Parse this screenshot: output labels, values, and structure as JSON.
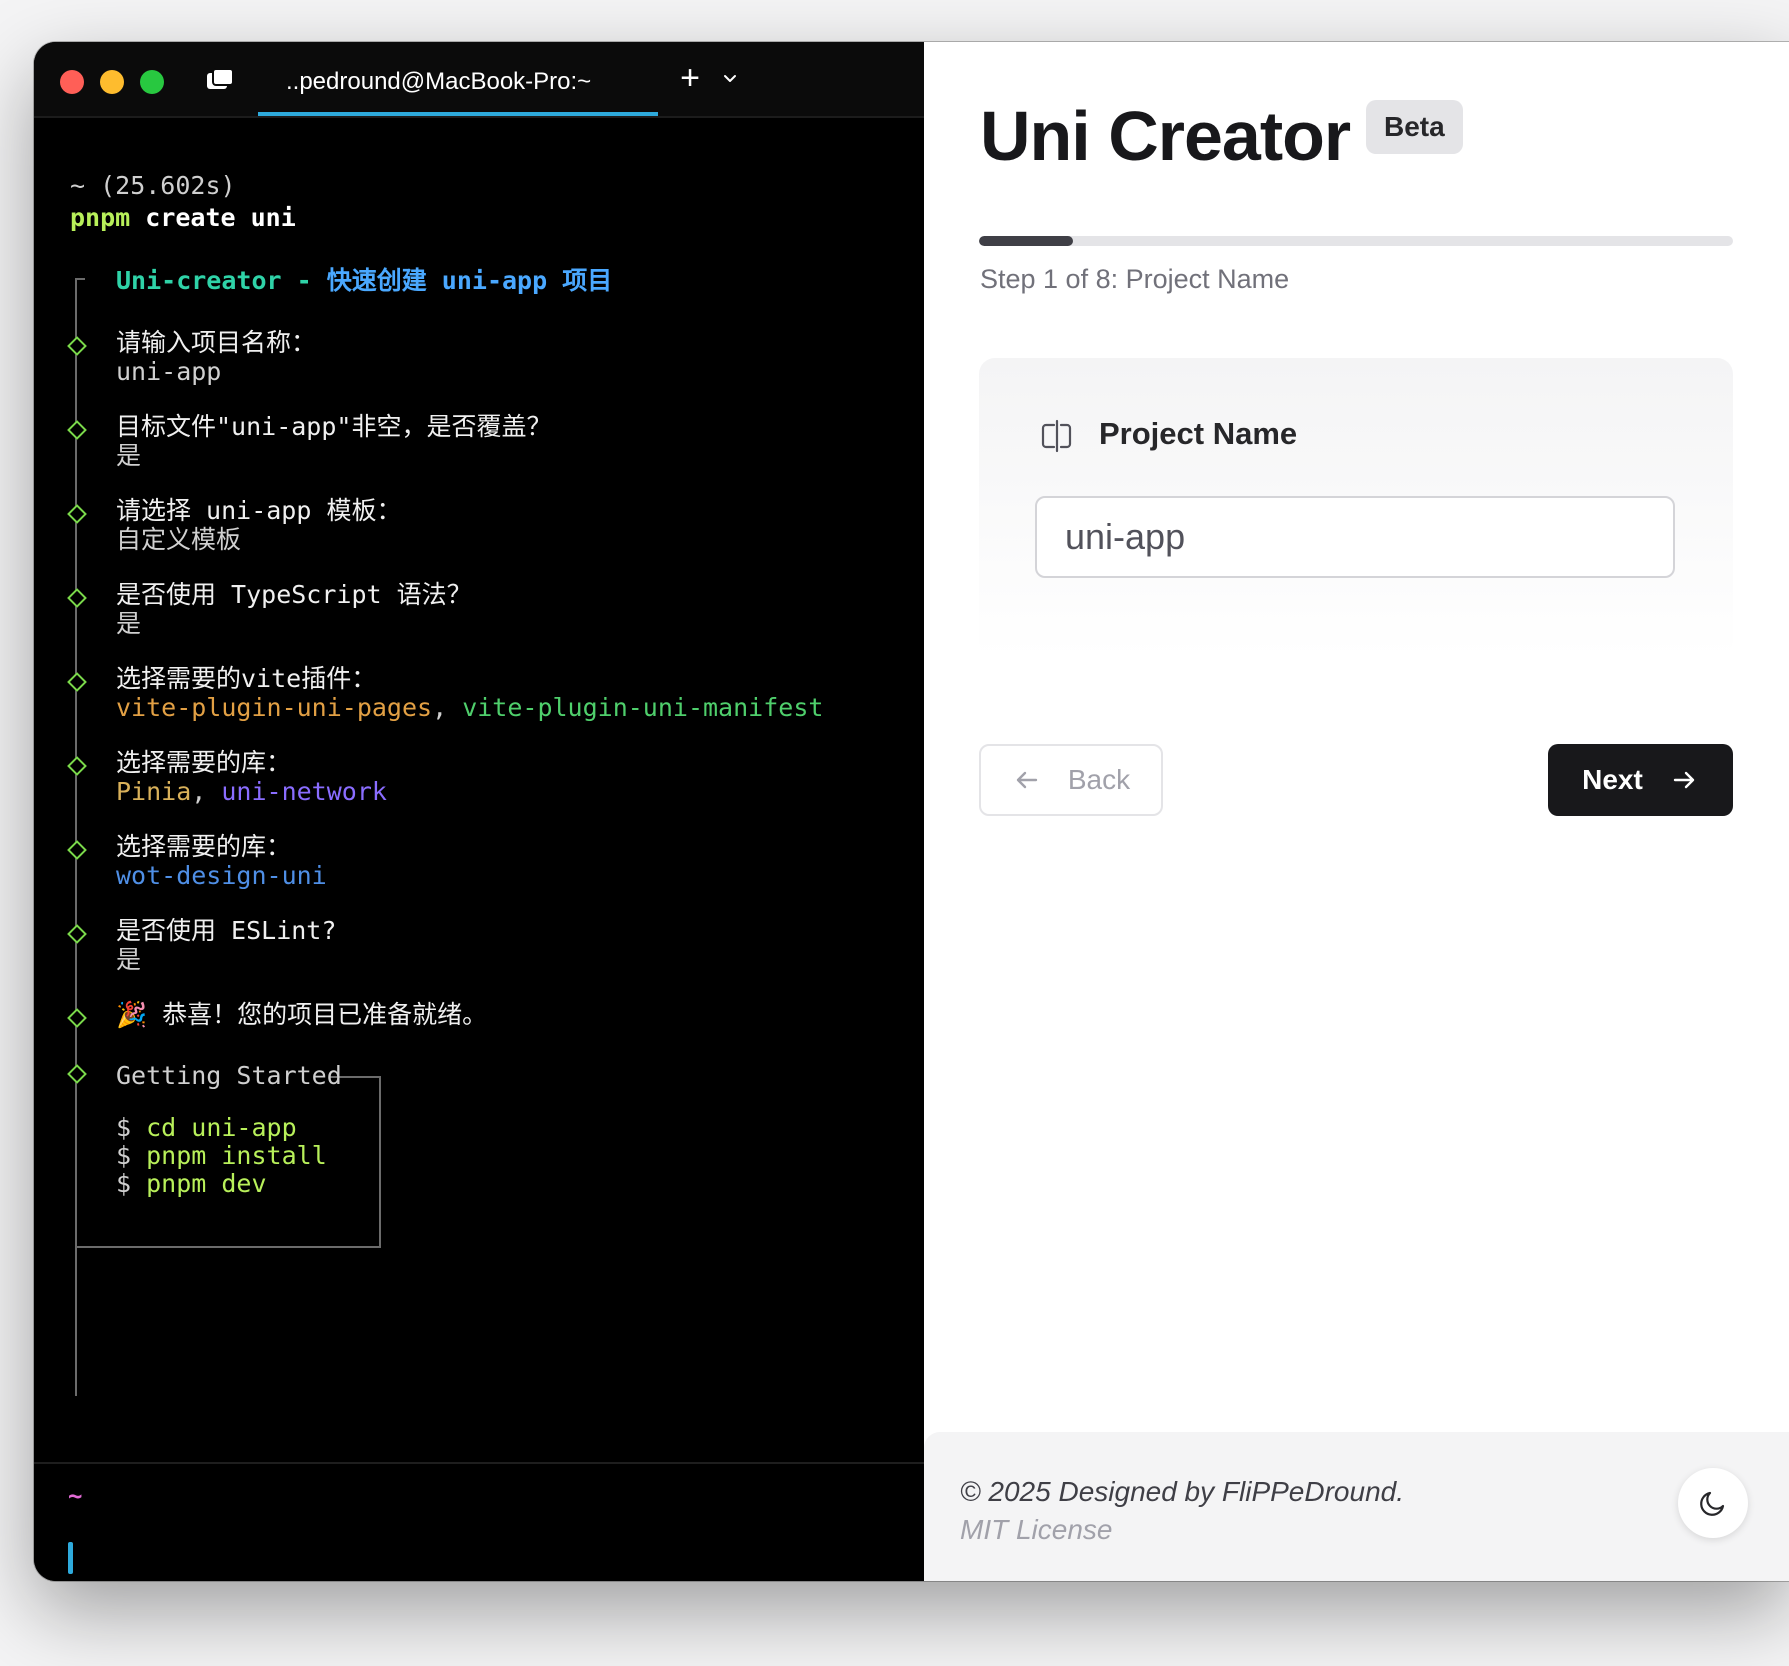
{
  "terminal": {
    "tab_title": "..pedround@MacBook-Pro:~",
    "new_tab_icon": "plus-icon",
    "timing": "~ (25.602s)",
    "command": {
      "tool": "pnpm",
      "rest": " create uni"
    },
    "header": {
      "name": "Uni-creator",
      "dash": " - ",
      "cn": "快速创建 ",
      "app": "uni-app",
      "cn2": " 项目"
    },
    "steps": [
      {
        "question": "请输入项目名称：",
        "answer": "uni-app"
      },
      {
        "question": "目标文件\"uni-app\"非空，是否覆盖？",
        "answer": "是"
      },
      {
        "question": "请选择 uni-app 模板：",
        "answer": "自定义模板"
      },
      {
        "question": "是否使用 TypeScript 语法？",
        "answer": "是"
      },
      {
        "question": "选择需要的vite插件：",
        "answer_parts": [
          "vite-plugin-uni-pages",
          ", ",
          "vite-plugin-uni-manifest"
        ]
      },
      {
        "question": "选择需要的库：",
        "answer_parts": [
          "Pinia",
          ", ",
          "uni-network"
        ]
      },
      {
        "question": "选择需要的库：",
        "answer": "wot-design-uni"
      },
      {
        "question": "是否使用 ESLint?",
        "answer": "是"
      }
    ],
    "success": "🎉 恭喜！您的项目已准备就绪。",
    "getting_started": {
      "title": "Getting Started",
      "commands": [
        {
          "prompt": "$",
          "text": "cd uni-app"
        },
        {
          "prompt": "$",
          "text": "pnpm install"
        },
        {
          "prompt": "$",
          "text": "pnpm dev"
        }
      ]
    },
    "prompt_symbol": "~"
  },
  "app": {
    "title": "Uni Creator",
    "badge": "Beta",
    "progress": {
      "current": 1,
      "total": 8
    },
    "step_label": "Step 1 of 8: Project Name",
    "field": {
      "label": "Project Name",
      "value": "uni-app",
      "icon": "text-cursor-input-icon"
    },
    "back_label": "Back",
    "next_label": "Next",
    "footer": {
      "copyright": "© 2025 Designed by FliPPeDround.",
      "license": "MIT License",
      "theme_icon": "moon-icon"
    }
  },
  "colors": {
    "terminal_bg": "#000000",
    "accent_tab": "#2eaadc",
    "prompt_green": "#b8f05a",
    "app_dark": "#18181b"
  }
}
